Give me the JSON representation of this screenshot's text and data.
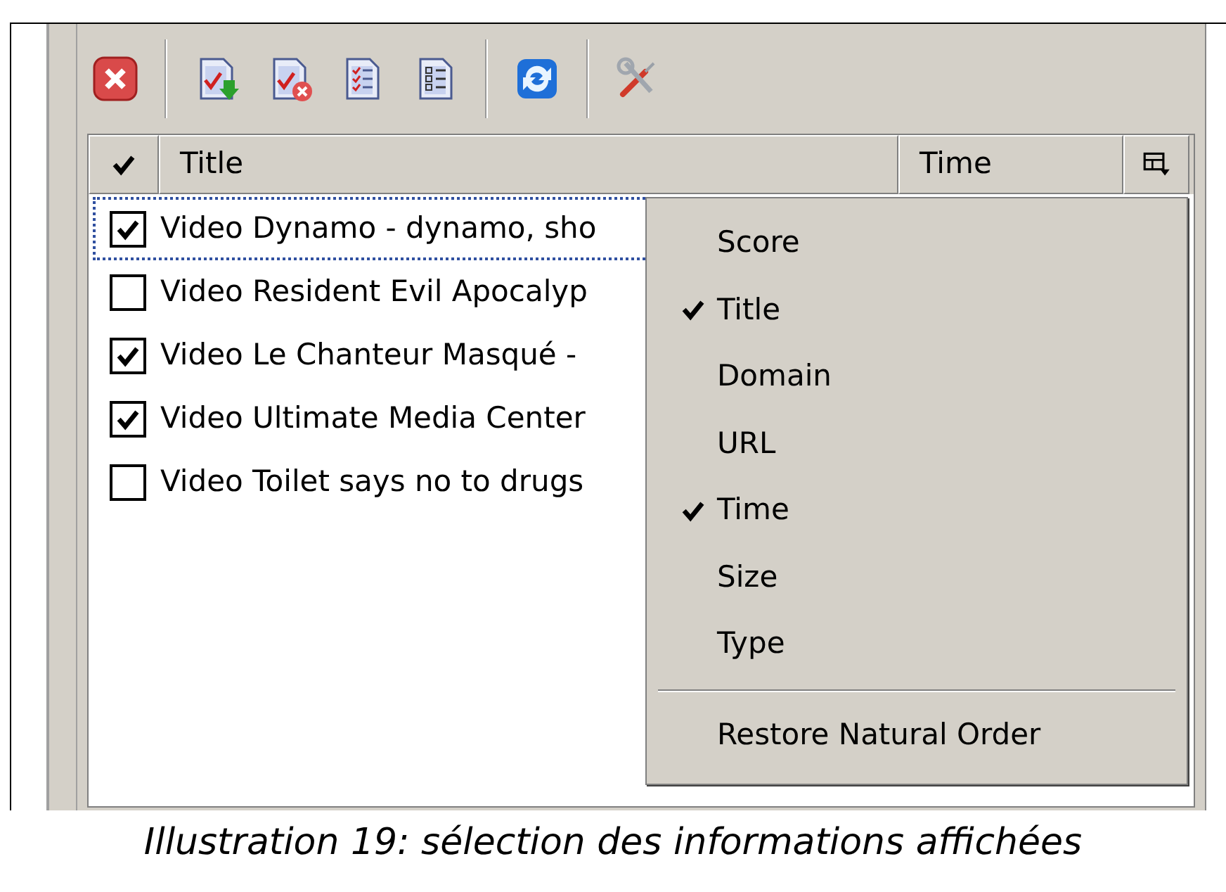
{
  "toolbar": {
    "buttons": [
      {
        "kind": "close"
      },
      {
        "kind": "separator"
      },
      {
        "kind": "check-download"
      },
      {
        "kind": "check-remove"
      },
      {
        "kind": "checklist"
      },
      {
        "kind": "list"
      },
      {
        "kind": "separator"
      },
      {
        "kind": "refresh"
      },
      {
        "kind": "separator"
      },
      {
        "kind": "tools"
      }
    ]
  },
  "table": {
    "columns": [
      {
        "kind": "check"
      },
      {
        "kind": "text",
        "label": "Title"
      },
      {
        "kind": "text",
        "label": "Time"
      },
      {
        "kind": "chooser"
      }
    ],
    "rows": [
      {
        "title": "Video Dynamo - dynamo, sho",
        "checked": true,
        "focused": true
      },
      {
        "title": "Video Resident Evil Apocalyp",
        "checked": false,
        "focused": false
      },
      {
        "title": "Video Le Chanteur Masqué -",
        "checked": true,
        "focused": false
      },
      {
        "title": "Video Ultimate Media Center",
        "checked": true,
        "focused": false
      },
      {
        "title": "Video Toilet says no to drugs",
        "checked": false,
        "focused": false
      }
    ]
  },
  "context_menu": {
    "items": [
      {
        "label": "Score",
        "checked": false
      },
      {
        "label": "Title",
        "checked": true
      },
      {
        "label": "Domain",
        "checked": false
      },
      {
        "label": "URL",
        "checked": false
      },
      {
        "label": "Time",
        "checked": true
      },
      {
        "label": "Size",
        "checked": false
      },
      {
        "label": "Type",
        "checked": false
      }
    ],
    "footer_item": "Restore Natural Order"
  },
  "caption": "Illustration 19: sélection des informations affichées"
}
